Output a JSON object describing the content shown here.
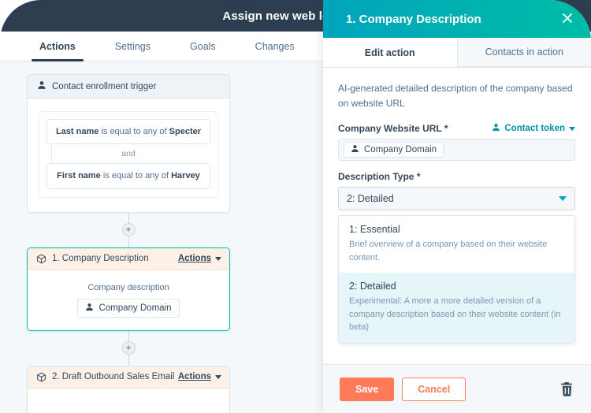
{
  "window": {
    "title": "Assign new web leads",
    "edit_icon": "pencil-icon"
  },
  "tabs": [
    {
      "label": "Actions",
      "active": true
    },
    {
      "label": "Settings",
      "active": false
    },
    {
      "label": "Goals",
      "active": false
    },
    {
      "label": "Changes",
      "active": false
    }
  ],
  "canvas": {
    "trigger": {
      "icon": "contact-icon",
      "title": "Contact enrollment trigger",
      "filters": [
        {
          "property": "Last name",
          "operator": "is equal to any of",
          "value": "Specter"
        },
        {
          "property": "First name",
          "operator": "is equal to any of",
          "value": "Harvey"
        }
      ],
      "joiner": "and"
    },
    "add_button_label": "+",
    "steps": [
      {
        "icon": "cube-icon",
        "title": "1. Company Description",
        "actions_label": "Actions",
        "body_label": "Company description",
        "token": "Company Domain",
        "selected": true
      },
      {
        "icon": "cube-icon",
        "title": "2. Draft Outbound Sales Email",
        "actions_label": "Actions",
        "selected": false
      }
    ]
  },
  "panel": {
    "title": "1. Company Description",
    "close_icon": "close-icon",
    "tabs": [
      {
        "label": "Edit action",
        "active": true
      },
      {
        "label": "Contacts in action",
        "active": false
      }
    ],
    "description": "AI-generated detailed description of the company based on website URL",
    "fields": {
      "website_url": {
        "label": "Company Website URL",
        "required_marker": "*",
        "token_link": "Contact token",
        "token_link_icon": "contact-icon",
        "value_chip": "Company Domain",
        "value_chip_icon": "contact-icon"
      },
      "description_type": {
        "label": "Description Type",
        "required_marker": "*",
        "selected": "2: Detailed",
        "options": [
          {
            "title": "1: Essential",
            "subtitle": "Brief overview of a company based on their website content.",
            "selected": false
          },
          {
            "title": "2: Detailed",
            "subtitle": "Experimental: A more a more detailed version of a company description based on their website content (in beta)",
            "selected": true
          }
        ]
      }
    },
    "footer": {
      "save_label": "Save",
      "cancel_label": "Cancel",
      "delete_icon": "trash-icon"
    }
  },
  "colors": {
    "navy": "#2d3e50",
    "teal_start": "#00a4bd",
    "teal_end": "#00bda5",
    "orange": "#ff7a59",
    "canvas_bg": "#f5f8fa",
    "link_teal": "#0091ae",
    "card_head_peach": "#fdf0e6"
  }
}
